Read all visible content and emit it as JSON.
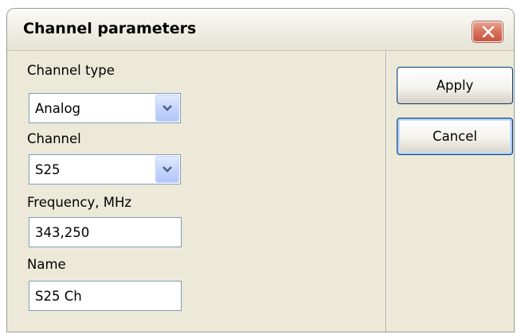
{
  "dialog": {
    "title": "Channel parameters",
    "close_icon": "close-icon"
  },
  "form": {
    "channel_type": {
      "label": "Channel type",
      "value": "Analog"
    },
    "channel": {
      "label": "Channel",
      "value": "S25"
    },
    "frequency": {
      "label": "Frequency, MHz",
      "value": "343,250"
    },
    "name": {
      "label": "Name",
      "value": "S25 Ch"
    }
  },
  "buttons": {
    "apply": "Apply",
    "cancel": "Cancel"
  },
  "colors": {
    "dialog_background": "#ece9d8",
    "close_button": "#d9735f",
    "field_border": "#7f9db9",
    "default_button_highlight": "#a9c8f5"
  }
}
